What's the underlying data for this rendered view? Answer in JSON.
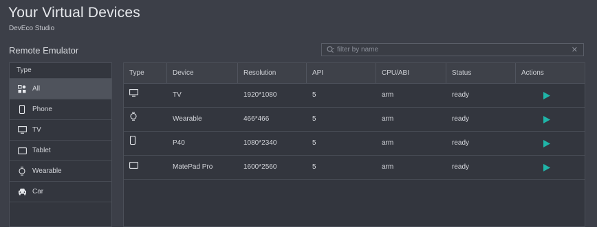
{
  "header": {
    "title": "Your Virtual Devices",
    "subtitle": "DevEco Studio",
    "section": "Remote Emulator"
  },
  "search": {
    "placeholder": "filter by name",
    "value": ""
  },
  "sidebar": {
    "header": "Type",
    "items": [
      {
        "label": "All",
        "icon": "grid-icon",
        "active": true
      },
      {
        "label": "Phone",
        "icon": "phone-icon"
      },
      {
        "label": "TV",
        "icon": "tv-icon"
      },
      {
        "label": "Tablet",
        "icon": "tablet-icon"
      },
      {
        "label": "Wearable",
        "icon": "watch-icon"
      },
      {
        "label": "Car",
        "icon": "car-icon"
      }
    ]
  },
  "table": {
    "columns": [
      "Type",
      "Device",
      "Resolution",
      "API",
      "CPU/ABI",
      "Status",
      "Actions"
    ],
    "rows": [
      {
        "type_icon": "tv-icon",
        "device": "TV",
        "resolution": "1920*1080",
        "api": "5",
        "cpu": "arm",
        "status": "ready"
      },
      {
        "type_icon": "watch-icon",
        "device": "Wearable",
        "resolution": "466*466",
        "api": "5",
        "cpu": "arm",
        "status": "ready"
      },
      {
        "type_icon": "phone-icon",
        "device": "P40",
        "resolution": "1080*2340",
        "api": "5",
        "cpu": "arm",
        "status": "ready"
      },
      {
        "type_icon": "tablet-icon",
        "device": "MatePad Pro",
        "resolution": "1600*2560",
        "api": "5",
        "cpu": "arm",
        "status": "ready"
      }
    ]
  },
  "colors": {
    "background": "#3c3f48",
    "panel": "#33363e",
    "accent": "#1fb5a8"
  }
}
